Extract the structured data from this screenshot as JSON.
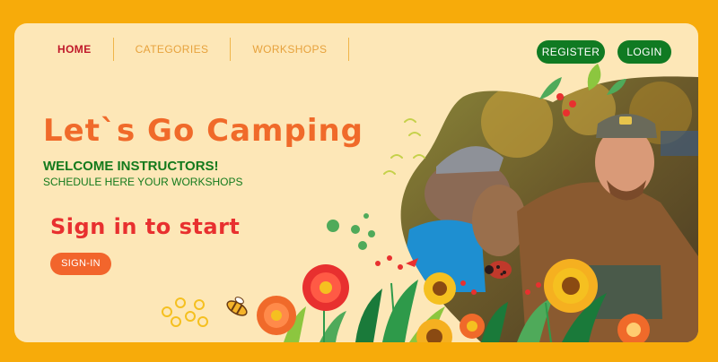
{
  "nav": {
    "home": "HOME",
    "categories": "CATEGORIES",
    "workshops": "WORKSHOPS"
  },
  "auth": {
    "register": "REGISTER",
    "login": "LOGIN"
  },
  "hero": {
    "headline": "Let`s Go Camping",
    "welcome": "WELCOME INSTRUCTORS!",
    "schedule": "SCHEDULE HERE YOUR WORKSHOPS",
    "signin_title": "Sign in to start",
    "signin_button": "SIGN-IN"
  },
  "colors": {
    "frame": "#f7ab0a",
    "card": "#fde7b7",
    "primary_green": "#107a22",
    "headline_orange": "#f06a2a",
    "signin_red": "#e8302f",
    "nav_active": "#c0182a"
  },
  "icons": [
    "ladybug-icon",
    "bee-icon",
    "sunflower-icon",
    "flower-icon",
    "leaf-icon"
  ]
}
